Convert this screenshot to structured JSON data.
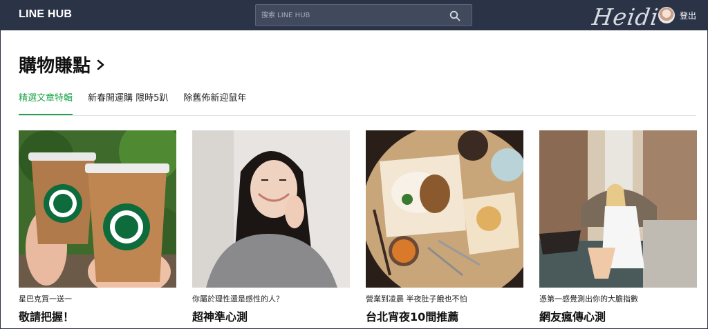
{
  "header": {
    "logo": "LINE HUB",
    "search_placeholder": "搜索 LINE HUB",
    "signature": "Heidi",
    "logout_label": "登出"
  },
  "section": {
    "title": "購物賺點",
    "tabs": [
      {
        "label": "精選文章特輯",
        "active": true
      },
      {
        "label": "新春開運購 限時5趴",
        "active": false
      },
      {
        "label": "除舊佈新迎鼠年",
        "active": false
      }
    ]
  },
  "cards": [
    {
      "subtitle": "星巴克買一送一",
      "title": "敬請把握！",
      "image": "two-starbucks-iced-coffees"
    },
    {
      "subtitle": "你屬於理性還是感性的人？",
      "title": "超神準心測",
      "image": "smiling-woman-in-grey-hoodie"
    },
    {
      "subtitle": "營業到凌晨 半夜肚子餓也不怕",
      "title": "台北宵夜10間推薦",
      "image": "food-on-wooden-table"
    },
    {
      "subtitle": "憑第一感覺測出你的大膽指數",
      "title": "網友瘋傳心測",
      "image": "woman-sitting-by-venice-canal"
    }
  ],
  "colors": {
    "topbar": "#2b3447",
    "accent": "#1fa64a"
  }
}
